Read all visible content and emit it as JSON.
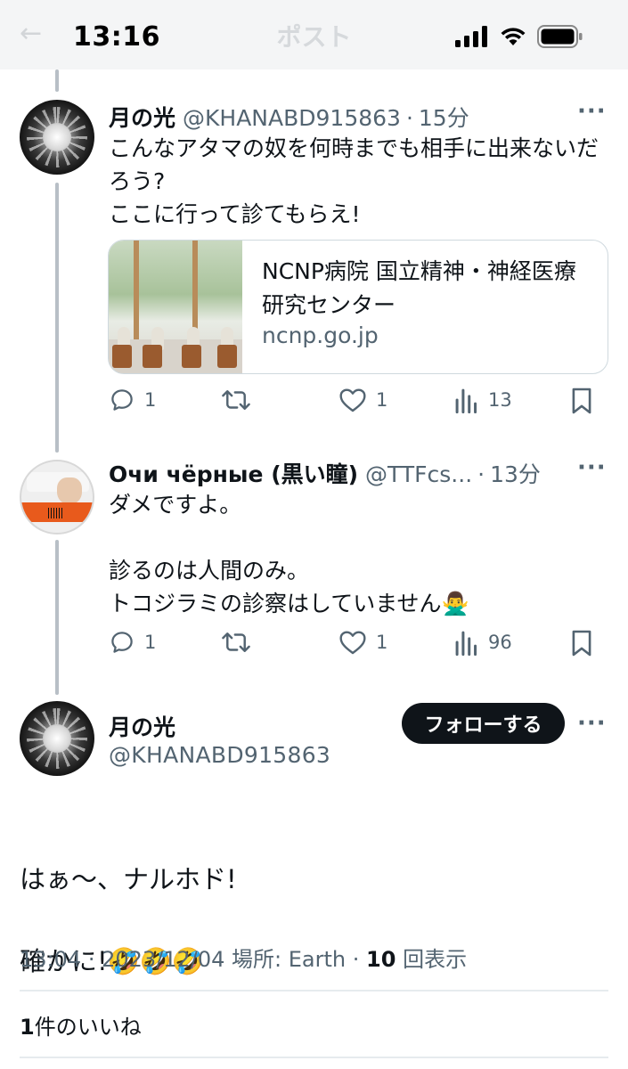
{
  "status_bar": {
    "time": "13:16"
  },
  "header": {
    "title": "ポスト"
  },
  "tweets": [
    {
      "name": "月の光",
      "handle": "@KHANABD915863",
      "ago": "15分",
      "text": "こんなアタマの奴を何時までも相手に出来ないだろう?\nここに行って診てもらえ!",
      "card": {
        "title": "NCNP病院 国立精神・神経医療研究センター",
        "domain": "ncnp.go.jp"
      },
      "replies": "1",
      "reposts": "",
      "likes": "1",
      "views": "13"
    },
    {
      "name": "Очи чёрные (黒い瞳)",
      "handle": "@TTFcs...",
      "ago": "13分",
      "text": "ダメですよ。\n\n診るのは人間のみ。\nトコジラミの診察はしていません🙅‍♂️",
      "replies": "1",
      "reposts": "",
      "likes": "1",
      "views": "96"
    }
  ],
  "main_tweet": {
    "name": "月の光",
    "handle": "@KHANABD915863",
    "follow_label": "フォローする",
    "text_line1": "はぁ〜、ナルホド!",
    "text_line2": "確かに!🤣🤣🤣",
    "time": "13:04",
    "date": "2023/12/04",
    "location": "場所: Earth",
    "views_count": "10",
    "views_label": "回表示",
    "likes_count": "1",
    "likes_label": "件のいいね"
  },
  "icons": {
    "reply": "reply-icon",
    "repost": "repost-icon",
    "like": "heart-icon",
    "views": "analytics-icon",
    "bookmark": "bookmark-icon",
    "more": "more-icon"
  },
  "colors": {
    "text": "#0f1419",
    "muted": "#536471",
    "thread_line": "#b8bfc6",
    "button": "#0f1419"
  }
}
